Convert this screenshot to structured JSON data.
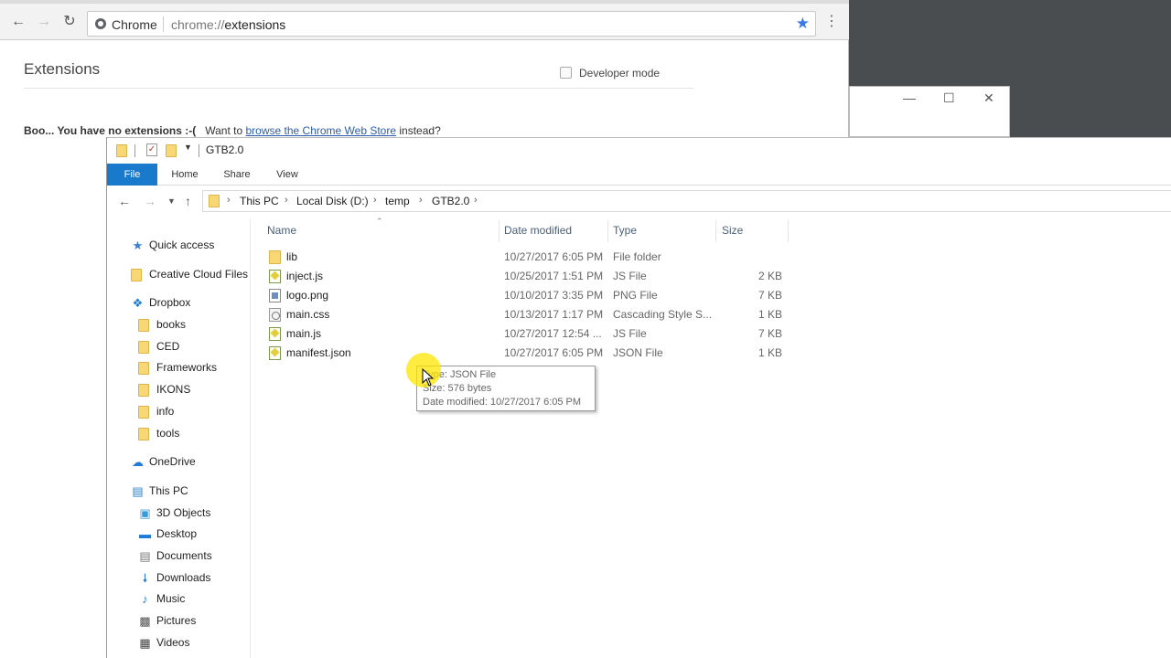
{
  "chrome": {
    "site_label": "Chrome",
    "url_scheme": "chrome://",
    "url_path": "extensions",
    "page_title": "Extensions",
    "developer_mode_label": "Developer mode",
    "developer_mode_checked": false,
    "no_extensions_bold": "Boo... You have no extensions :-(",
    "want_to": "Want to",
    "store_link": "browse the Chrome Web Store",
    "instead": "instead?"
  },
  "explorer": {
    "window_title": "GTB2.0",
    "ribbon_tabs": [
      "File",
      "Home",
      "Share",
      "View"
    ],
    "breadcrumb": [
      "This PC",
      "Local Disk (D:)",
      "temp",
      "GTB2.0"
    ],
    "columns": {
      "name": "Name",
      "date": "Date modified",
      "type": "Type",
      "size": "Size"
    },
    "nav": [
      {
        "label": "Quick access",
        "icon": "star-icon"
      },
      {
        "label": "Creative Cloud Files",
        "icon": "folder-icon"
      },
      {
        "label": "Dropbox",
        "icon": "dropbox-icon"
      },
      {
        "label": "books",
        "icon": "folder-icon"
      },
      {
        "label": "CED",
        "icon": "folder-icon"
      },
      {
        "label": "Frameworks",
        "icon": "folder-icon"
      },
      {
        "label": "IKONS",
        "icon": "folder-icon"
      },
      {
        "label": "info",
        "icon": "folder-icon"
      },
      {
        "label": "tools",
        "icon": "folder-icon"
      },
      {
        "label": "OneDrive",
        "icon": "cloud-icon"
      },
      {
        "label": "This PC",
        "icon": "computer-icon"
      },
      {
        "label": "3D Objects",
        "icon": "cube-icon"
      },
      {
        "label": "Desktop",
        "icon": "desktop-icon"
      },
      {
        "label": "Documents",
        "icon": "documents-icon"
      },
      {
        "label": "Downloads",
        "icon": "download-icon"
      },
      {
        "label": "Music",
        "icon": "music-icon"
      },
      {
        "label": "Pictures",
        "icon": "pictures-icon"
      },
      {
        "label": "Videos",
        "icon": "videos-icon"
      }
    ],
    "files": [
      {
        "name": "lib",
        "date": "10/27/2017 6:05 PM",
        "type": "File folder",
        "size": "",
        "icon": "folder-icon"
      },
      {
        "name": "inject.js",
        "date": "10/25/2017 1:51 PM",
        "type": "JS File",
        "size": "2 KB",
        "icon": "js-file-icon"
      },
      {
        "name": "logo.png",
        "date": "10/10/2017 3:35 PM",
        "type": "PNG File",
        "size": "7 KB",
        "icon": "png-file-icon"
      },
      {
        "name": "main.css",
        "date": "10/13/2017 1:17 PM",
        "type": "Cascading Style S...",
        "size": "1 KB",
        "icon": "css-file-icon"
      },
      {
        "name": "main.js",
        "date": "10/27/2017 12:54 ...",
        "type": "JS File",
        "size": "7 KB",
        "icon": "js-file-icon"
      },
      {
        "name": "manifest.json",
        "date": "10/27/2017 6:05 PM",
        "type": "JSON File",
        "size": "1 KB",
        "icon": "json-file-icon"
      }
    ],
    "tooltip": {
      "type_line": "Type: JSON File",
      "size_line": "Size: 576 bytes",
      "date_line": "Date modified: 10/27/2017 6:05 PM"
    }
  },
  "colors": {
    "ribbon_file_tab": "#1979ca",
    "link": "#2a5db0",
    "star": "#3b78e7",
    "folder": "#f8d775",
    "cursor_highlight": "#ffe600"
  }
}
